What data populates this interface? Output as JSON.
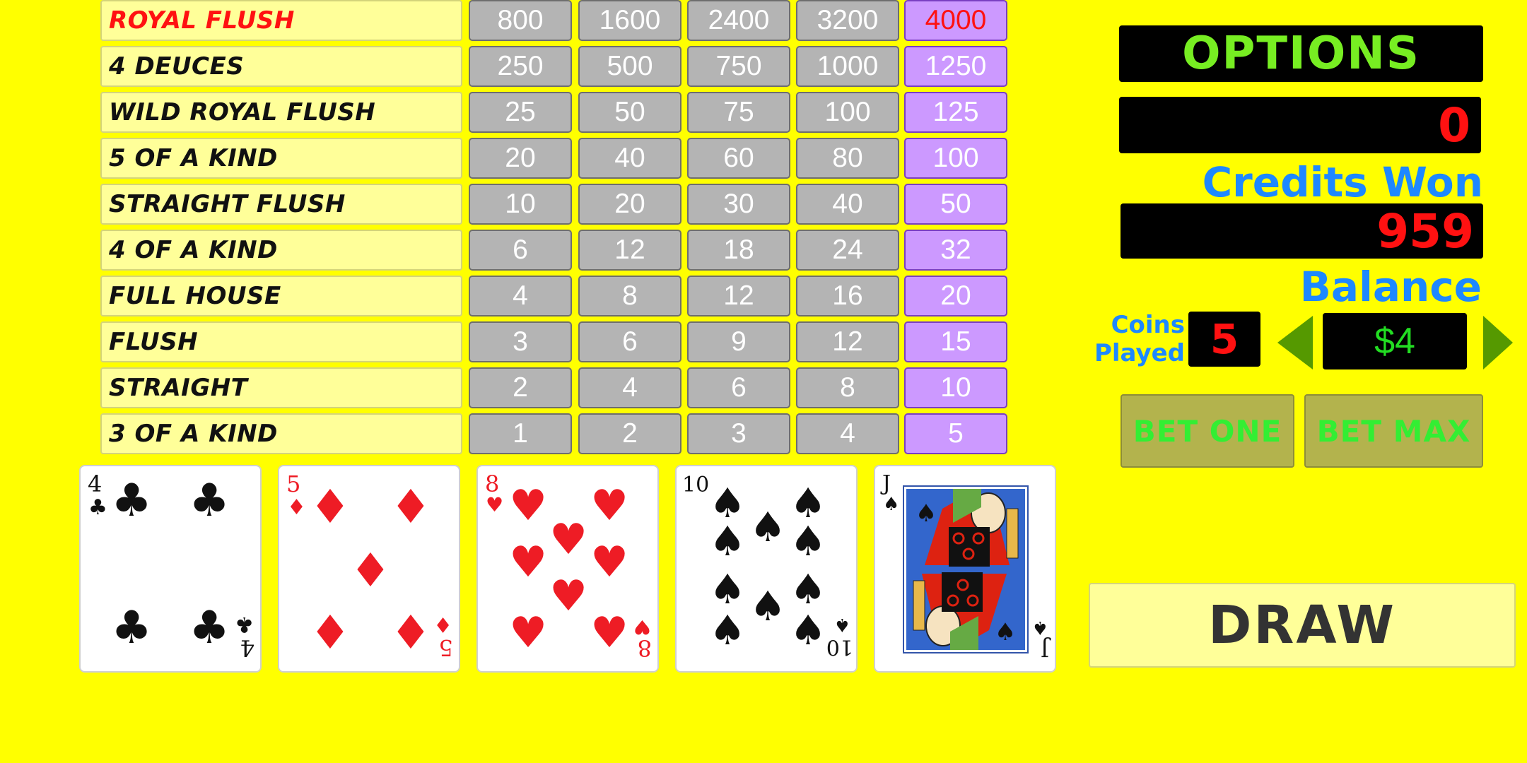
{
  "paytable": {
    "rows": [
      {
        "hand": "ROYAL FLUSH",
        "pays": [
          "800",
          "1600",
          "2400",
          "3200",
          "4000"
        ]
      },
      {
        "hand": "4 DEUCES",
        "pays": [
          "250",
          "500",
          "750",
          "1000",
          "1250"
        ]
      },
      {
        "hand": "WILD ROYAL FLUSH",
        "pays": [
          "25",
          "50",
          "75",
          "100",
          "125"
        ]
      },
      {
        "hand": "5 OF A KIND",
        "pays": [
          "20",
          "40",
          "60",
          "80",
          "100"
        ]
      },
      {
        "hand": "STRAIGHT FLUSH",
        "pays": [
          "10",
          "20",
          "30",
          "40",
          "50"
        ]
      },
      {
        "hand": "4 OF A KIND",
        "pays": [
          "6",
          "12",
          "18",
          "24",
          "32"
        ]
      },
      {
        "hand": "FULL HOUSE",
        "pays": [
          "4",
          "8",
          "12",
          "16",
          "20"
        ]
      },
      {
        "hand": "FLUSH",
        "pays": [
          "3",
          "6",
          "9",
          "12",
          "15"
        ]
      },
      {
        "hand": "STRAIGHT",
        "pays": [
          "2",
          "4",
          "6",
          "8",
          "10"
        ]
      },
      {
        "hand": "3 OF A KIND",
        "pays": [
          "1",
          "2",
          "3",
          "4",
          "5"
        ]
      }
    ],
    "active_column": 5
  },
  "cards": [
    {
      "rank": "4",
      "suit": "clubs",
      "symbol": "♣",
      "color": "#111111",
      "name": "four-of-clubs"
    },
    {
      "rank": "5",
      "suit": "diamonds",
      "symbol": "♦",
      "color": "#ee1c25",
      "name": "five-of-diamonds"
    },
    {
      "rank": "8",
      "suit": "hearts",
      "symbol": "♥",
      "color": "#ee1c25",
      "name": "eight-of-hearts"
    },
    {
      "rank": "10",
      "suit": "spades",
      "symbol": "♠",
      "color": "#111111",
      "name": "ten-of-spades"
    },
    {
      "rank": "J",
      "suit": "spades",
      "symbol": "♠",
      "color": "#111111",
      "name": "jack-of-spades"
    }
  ],
  "panel": {
    "options_label": "OPTIONS",
    "credits_won_value": "0",
    "credits_won_label": "Credits Won",
    "balance_value": "959",
    "balance_label": "Balance",
    "coins_played_label_line1": "Coins",
    "coins_played_label_line2": "Played",
    "coins_played_value": "5",
    "denomination": "$4",
    "bet_one_label": "BET ONE",
    "bet_max_label": "BET MAX",
    "draw_label": "DRAW"
  },
  "colors": {
    "background": "#ffff00",
    "active_column": "#cc99ff",
    "inactive_column": "#b4b4b4",
    "label_blue": "#1e88ff",
    "digit_red": "#ff1111",
    "options_green": "#77ee22",
    "denomination_green": "#22dd22",
    "arrow_green": "#559900"
  }
}
